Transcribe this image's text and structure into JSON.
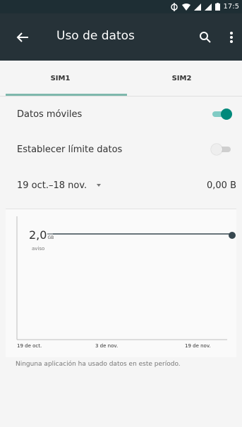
{
  "status_bar": {
    "time": "17:5"
  },
  "toolbar": {
    "title": "Uso de datos"
  },
  "tabs": [
    {
      "label": "SIM1"
    },
    {
      "label": "SIM2"
    }
  ],
  "settings": {
    "mobile_data_label": "Datos móviles",
    "mobile_data_enabled": true,
    "data_limit_label": "Establecer límite datos",
    "data_limit_enabled": false
  },
  "period": {
    "label": "19 oct.–18 nov.",
    "usage": "0,00 B"
  },
  "chart": {
    "warning_value": "2,0",
    "warning_unit": "GB",
    "warning_label": "aviso",
    "x_ticks": [
      "19 de oct.",
      "3 de nov.",
      "19 de nov."
    ]
  },
  "footer": {
    "message": "Ninguna aplicación ha usado datos en este período."
  },
  "colors": {
    "toolbar": "#263238",
    "accent": "#00897b",
    "tab_indicator": "#7fb8ac"
  }
}
